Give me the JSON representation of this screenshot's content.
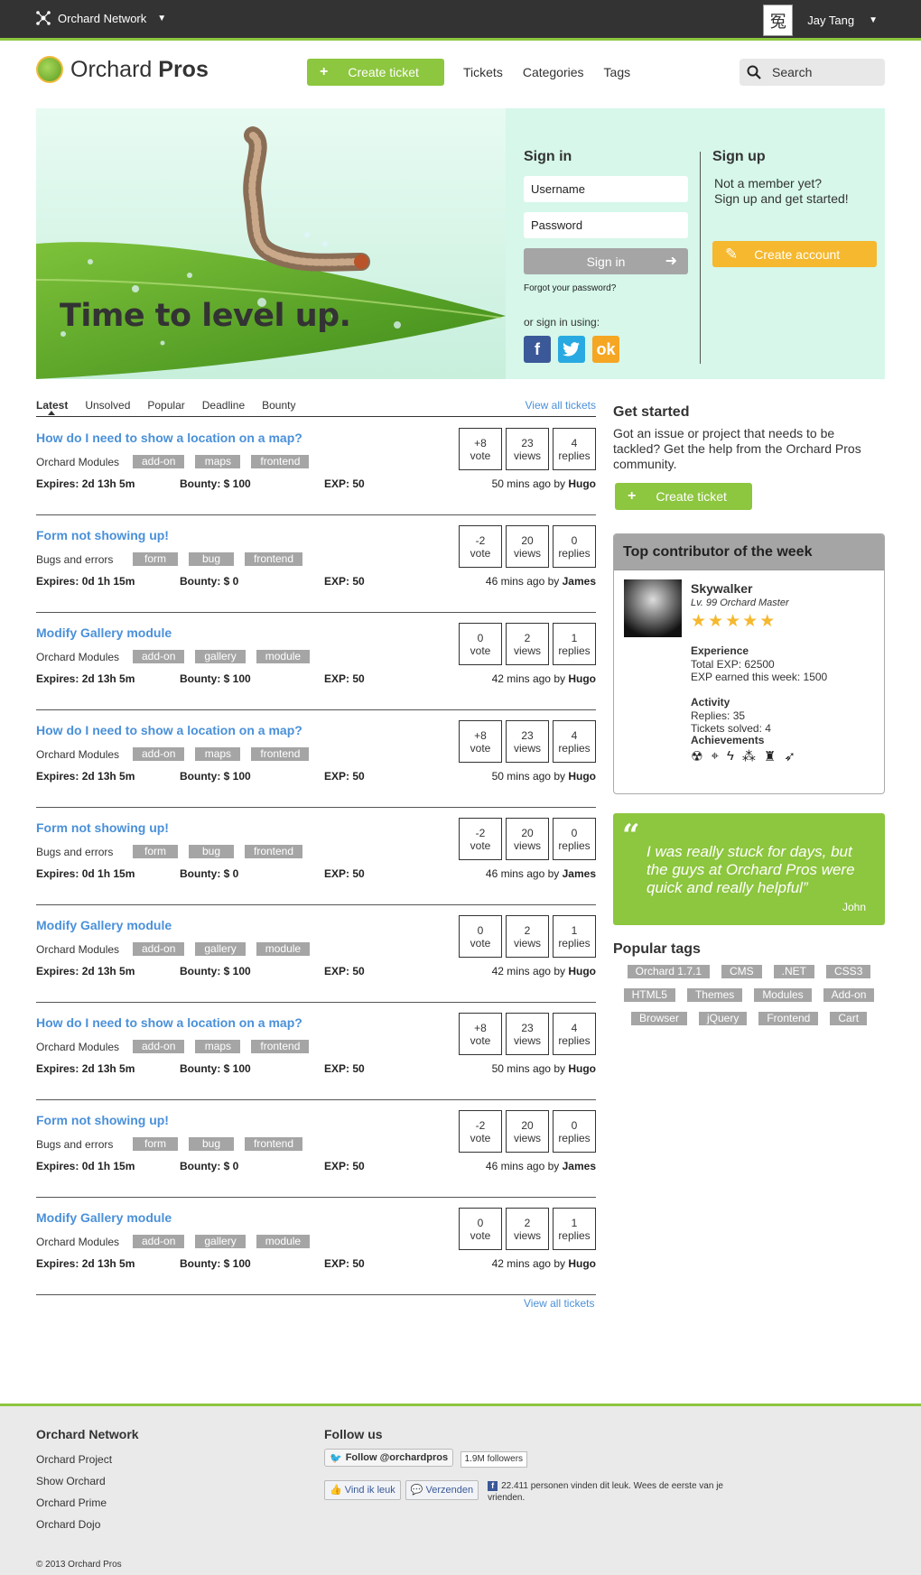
{
  "topbar": {
    "network": "Orchard Network",
    "user": "Jay Tang",
    "avatar_glyph": "冤"
  },
  "header": {
    "logo_a": "Orchard ",
    "logo_b": "Pros",
    "create_ticket": "Create ticket",
    "nav": [
      "Tickets",
      "Categories",
      "Tags"
    ],
    "search_placeholder": "Search"
  },
  "hero": {
    "title": "Time to level up.",
    "signin": {
      "heading": "Sign in",
      "username_placeholder": "Username",
      "password_placeholder": "Password",
      "button": "Sign in",
      "forgot": "Forgot your password?",
      "or_using": "or sign in using:"
    },
    "signup": {
      "heading": "Sign up",
      "text1": "Not a member yet?",
      "text2": "Sign up and get started!",
      "button": "Create account"
    }
  },
  "tabs": {
    "items": [
      "Latest",
      "Unsolved",
      "Popular",
      "Deadline",
      "Bounty"
    ],
    "active": "Latest",
    "view_all": "View all tickets"
  },
  "tickets": [
    {
      "title": "How do I need to show a location on a map?",
      "category": "Orchard Modules",
      "tags": [
        "add-on",
        "maps",
        "frontend"
      ],
      "expires": "Expires: 2d 13h 5m",
      "bounty": "Bounty: $ 100",
      "exp": "EXP: 50",
      "ago": "50 mins ago by",
      "author": "Hugo",
      "vote": "+8",
      "views": "23",
      "replies": "4"
    },
    {
      "title": "Form not showing up!",
      "category": "Bugs and errors",
      "tags": [
        "form",
        "bug",
        "frontend"
      ],
      "expires": "Expires: 0d 1h 15m",
      "bounty": "Bounty: $ 0",
      "exp": "EXP: 50",
      "ago": "46 mins ago by",
      "author": "James",
      "vote": "-2",
      "views": "20",
      "replies": "0"
    },
    {
      "title": "Modify Gallery module",
      "category": "Orchard Modules",
      "tags": [
        "add-on",
        "gallery",
        "module"
      ],
      "expires": "Expires: 2d 13h 5m",
      "bounty": "Bounty: $ 100",
      "exp": "EXP: 50",
      "ago": "42 mins ago by",
      "author": "Hugo",
      "vote": "0",
      "views": "2",
      "replies": "1"
    },
    {
      "title": "How do I need to show a location on a map?",
      "category": "Orchard Modules",
      "tags": [
        "add-on",
        "maps",
        "frontend"
      ],
      "expires": "Expires: 2d 13h 5m",
      "bounty": "Bounty: $ 100",
      "exp": "EXP: 50",
      "ago": "50 mins ago by",
      "author": "Hugo",
      "vote": "+8",
      "views": "23",
      "replies": "4"
    },
    {
      "title": "Form not showing up!",
      "category": "Bugs and errors",
      "tags": [
        "form",
        "bug",
        "frontend"
      ],
      "expires": "Expires: 0d 1h 15m",
      "bounty": "Bounty: $ 0",
      "exp": "EXP: 50",
      "ago": "46 mins ago by",
      "author": "James",
      "vote": "-2",
      "views": "20",
      "replies": "0"
    },
    {
      "title": "Modify Gallery module",
      "category": "Orchard Modules",
      "tags": [
        "add-on",
        "gallery",
        "module"
      ],
      "expires": "Expires: 2d 13h 5m",
      "bounty": "Bounty: $ 100",
      "exp": "EXP: 50",
      "ago": "42 mins ago by",
      "author": "Hugo",
      "vote": "0",
      "views": "2",
      "replies": "1"
    },
    {
      "title": "How do I need to show a location on a map?",
      "category": "Orchard Modules",
      "tags": [
        "add-on",
        "maps",
        "frontend"
      ],
      "expires": "Expires: 2d 13h 5m",
      "bounty": "Bounty: $ 100",
      "exp": "EXP: 50",
      "ago": "50 mins ago by",
      "author": "Hugo",
      "vote": "+8",
      "views": "23",
      "replies": "4"
    },
    {
      "title": "Form not showing up!",
      "category": "Bugs and errors",
      "tags": [
        "form",
        "bug",
        "frontend"
      ],
      "expires": "Expires: 0d 1h 15m",
      "bounty": "Bounty: $ 0",
      "exp": "EXP: 50",
      "ago": "46 mins ago by",
      "author": "James",
      "vote": "-2",
      "views": "20",
      "replies": "0"
    },
    {
      "title": "Modify Gallery module",
      "category": "Orchard Modules",
      "tags": [
        "add-on",
        "gallery",
        "module"
      ],
      "expires": "Expires: 2d 13h 5m",
      "bounty": "Bounty: $ 100",
      "exp": "EXP: 50",
      "ago": "42 mins ago by",
      "author": "Hugo",
      "vote": "0",
      "views": "2",
      "replies": "1"
    }
  ],
  "stat_labels": {
    "vote": "vote",
    "views": "views",
    "replies": "replies"
  },
  "sidebar": {
    "get_started": {
      "heading": "Get started",
      "text": "Got an issue or project that needs to be tackled? Get the help from the Orchard Pros community.",
      "button": "Create ticket"
    },
    "contributor": {
      "heading": "Top contributor of the week",
      "name": "Skywalker",
      "level": "Lv. 99 Orchard Master",
      "rating": 5,
      "experience_label": "Experience",
      "total_exp": "Total EXP: 62500",
      "week_exp": "EXP earned this week: 1500",
      "activity_label": "Activity",
      "replies": "Replies: 35",
      "tickets_solved": "Tickets solved: 4",
      "achievements_label": "Achievements",
      "achievement_icons": [
        "radiation-icon",
        "crosshair-icon",
        "lightning-icon",
        "stars-icon",
        "trophy-icon",
        "rocket-icon"
      ]
    },
    "quote": {
      "text": "I was really stuck for days, but the guys at Orchard Pros were quick and really helpful”",
      "author": "John"
    },
    "popular_tags": {
      "heading": "Popular tags",
      "tags": [
        "Orchard 1.7.1",
        "CMS",
        ".NET",
        "CSS3",
        "HTML5",
        "Themes",
        "Modules",
        "Add-on",
        "Browser",
        "jQuery",
        "Frontend",
        "Cart"
      ]
    }
  },
  "footer": {
    "network_heading": "Orchard Network",
    "links": [
      "Orchard Project",
      "Show Orchard",
      "Orchard Prime",
      "Orchard Dojo"
    ],
    "follow_heading": "Follow us",
    "twitter_button": "Follow @orchardpros",
    "twitter_count": "1.9M followers",
    "fb_like": "Vind ik leuk",
    "fb_send": "Verzenden",
    "fb_text": "22.411 personen vinden dit leuk. Wees de eerste van je vrienden.",
    "copyright": "© 2013 Orchard Pros"
  },
  "colors": {
    "accent": "#8dc63f",
    "link": "#4a90d9",
    "warning": "#f5b82e",
    "tag": "#a5a5a5",
    "topbar": "#333333"
  }
}
